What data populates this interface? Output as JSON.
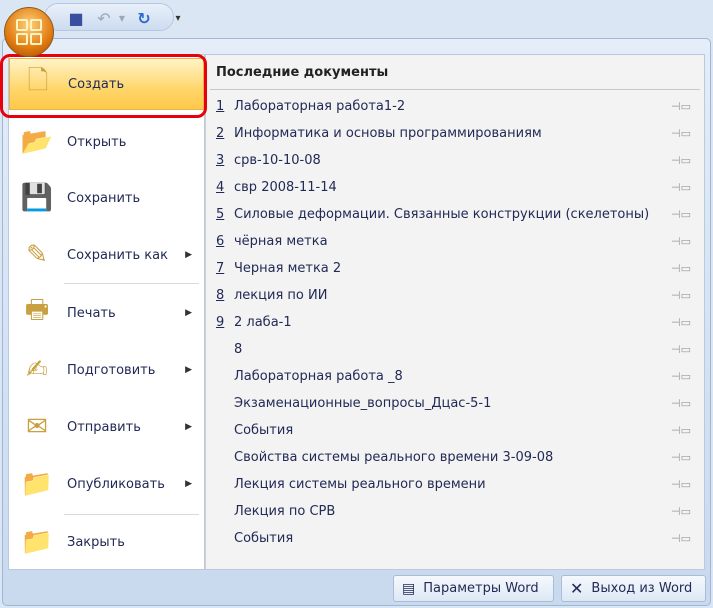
{
  "quick_access": {
    "save": "save-icon",
    "undo": "undo-icon",
    "redo": "redo-icon",
    "customize": "customize-icon"
  },
  "menu": [
    {
      "label": "Создать",
      "icon": "new-document-icon",
      "submenu": false
    },
    {
      "label": "Открыть",
      "icon": "open-folder-icon",
      "submenu": false
    },
    {
      "label": "Сохранить",
      "icon": "save-icon",
      "submenu": false
    },
    {
      "label": "Сохранить как",
      "icon": "save-as-icon",
      "submenu": true
    },
    {
      "label": "Печать",
      "icon": "print-icon",
      "submenu": true
    },
    {
      "label": "Подготовить",
      "icon": "prepare-icon",
      "submenu": true
    },
    {
      "label": "Отправить",
      "icon": "send-icon",
      "submenu": true
    },
    {
      "label": "Опубликовать",
      "icon": "publish-icon",
      "submenu": true
    },
    {
      "label": "Закрыть",
      "icon": "close-folder-icon",
      "submenu": false
    }
  ],
  "recent": {
    "title": "Последние документы",
    "items": [
      {
        "num": "1",
        "name": "Лабораторная работа1-2"
      },
      {
        "num": "2",
        "name": "Информатика и основы программированиям"
      },
      {
        "num": "3",
        "name": "срв-10-10-08"
      },
      {
        "num": "4",
        "name": "свр 2008-11-14"
      },
      {
        "num": "5",
        "name": "Силовые деформации. Связанные конструкции (скелетоны)"
      },
      {
        "num": "6",
        "name": "чёрная метка"
      },
      {
        "num": "7",
        "name": "Черная метка 2"
      },
      {
        "num": "8",
        "name": "лекция по ИИ"
      },
      {
        "num": "9",
        "name": "2 лаба-1"
      },
      {
        "num": "",
        "name": "8"
      },
      {
        "num": "",
        "name": "Лабораторная работа _8"
      },
      {
        "num": "",
        "name": "Экзаменационные_вопросы_Дцас-5-1"
      },
      {
        "num": "",
        "name": "События"
      },
      {
        "num": "",
        "name": "Свойства системы реального времени 3-09-08"
      },
      {
        "num": "",
        "name": "Лекция системы реального времени"
      },
      {
        "num": "",
        "name": "Лекция по СРВ"
      },
      {
        "num": "",
        "name": "События"
      }
    ]
  },
  "footer": {
    "options": "Параметры Word",
    "exit": "Выход из Word"
  }
}
